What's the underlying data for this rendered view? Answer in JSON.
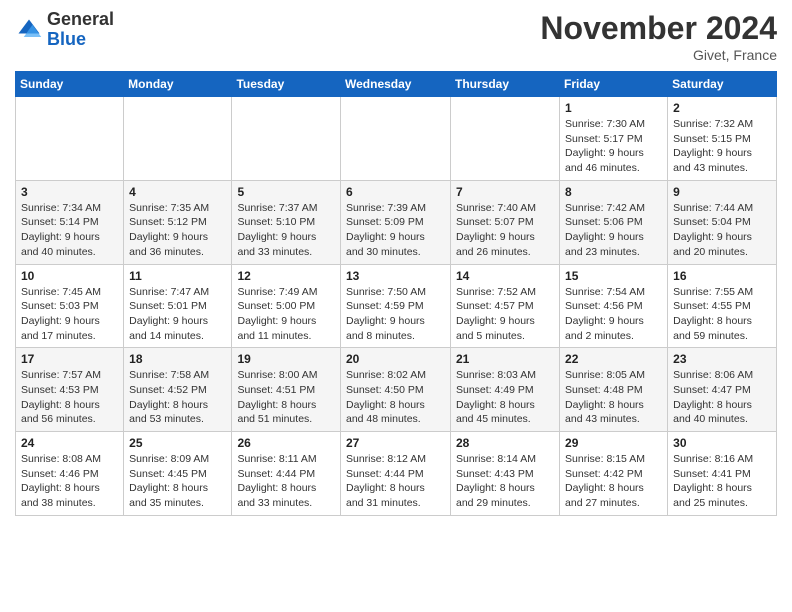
{
  "logo": {
    "line1": "General",
    "line2": "Blue"
  },
  "title": "November 2024",
  "location": "Givet, France",
  "days_of_week": [
    "Sunday",
    "Monday",
    "Tuesday",
    "Wednesday",
    "Thursday",
    "Friday",
    "Saturday"
  ],
  "weeks": [
    [
      null,
      null,
      null,
      null,
      null,
      {
        "day": "1",
        "sunrise": "7:30 AM",
        "sunset": "5:17 PM",
        "daylight": "9 hours and 46 minutes."
      },
      {
        "day": "2",
        "sunrise": "7:32 AM",
        "sunset": "5:15 PM",
        "daylight": "9 hours and 43 minutes."
      }
    ],
    [
      {
        "day": "3",
        "sunrise": "7:34 AM",
        "sunset": "5:14 PM",
        "daylight": "9 hours and 40 minutes."
      },
      {
        "day": "4",
        "sunrise": "7:35 AM",
        "sunset": "5:12 PM",
        "daylight": "9 hours and 36 minutes."
      },
      {
        "day": "5",
        "sunrise": "7:37 AM",
        "sunset": "5:10 PM",
        "daylight": "9 hours and 33 minutes."
      },
      {
        "day": "6",
        "sunrise": "7:39 AM",
        "sunset": "5:09 PM",
        "daylight": "9 hours and 30 minutes."
      },
      {
        "day": "7",
        "sunrise": "7:40 AM",
        "sunset": "5:07 PM",
        "daylight": "9 hours and 26 minutes."
      },
      {
        "day": "8",
        "sunrise": "7:42 AM",
        "sunset": "5:06 PM",
        "daylight": "9 hours and 23 minutes."
      },
      {
        "day": "9",
        "sunrise": "7:44 AM",
        "sunset": "5:04 PM",
        "daylight": "9 hours and 20 minutes."
      }
    ],
    [
      {
        "day": "10",
        "sunrise": "7:45 AM",
        "sunset": "5:03 PM",
        "daylight": "9 hours and 17 minutes."
      },
      {
        "day": "11",
        "sunrise": "7:47 AM",
        "sunset": "5:01 PM",
        "daylight": "9 hours and 14 minutes."
      },
      {
        "day": "12",
        "sunrise": "7:49 AM",
        "sunset": "5:00 PM",
        "daylight": "9 hours and 11 minutes."
      },
      {
        "day": "13",
        "sunrise": "7:50 AM",
        "sunset": "4:59 PM",
        "daylight": "9 hours and 8 minutes."
      },
      {
        "day": "14",
        "sunrise": "7:52 AM",
        "sunset": "4:57 PM",
        "daylight": "9 hours and 5 minutes."
      },
      {
        "day": "15",
        "sunrise": "7:54 AM",
        "sunset": "4:56 PM",
        "daylight": "9 hours and 2 minutes."
      },
      {
        "day": "16",
        "sunrise": "7:55 AM",
        "sunset": "4:55 PM",
        "daylight": "8 hours and 59 minutes."
      }
    ],
    [
      {
        "day": "17",
        "sunrise": "7:57 AM",
        "sunset": "4:53 PM",
        "daylight": "8 hours and 56 minutes."
      },
      {
        "day": "18",
        "sunrise": "7:58 AM",
        "sunset": "4:52 PM",
        "daylight": "8 hours and 53 minutes."
      },
      {
        "day": "19",
        "sunrise": "8:00 AM",
        "sunset": "4:51 PM",
        "daylight": "8 hours and 51 minutes."
      },
      {
        "day": "20",
        "sunrise": "8:02 AM",
        "sunset": "4:50 PM",
        "daylight": "8 hours and 48 minutes."
      },
      {
        "day": "21",
        "sunrise": "8:03 AM",
        "sunset": "4:49 PM",
        "daylight": "8 hours and 45 minutes."
      },
      {
        "day": "22",
        "sunrise": "8:05 AM",
        "sunset": "4:48 PM",
        "daylight": "8 hours and 43 minutes."
      },
      {
        "day": "23",
        "sunrise": "8:06 AM",
        "sunset": "4:47 PM",
        "daylight": "8 hours and 40 minutes."
      }
    ],
    [
      {
        "day": "24",
        "sunrise": "8:08 AM",
        "sunset": "4:46 PM",
        "daylight": "8 hours and 38 minutes."
      },
      {
        "day": "25",
        "sunrise": "8:09 AM",
        "sunset": "4:45 PM",
        "daylight": "8 hours and 35 minutes."
      },
      {
        "day": "26",
        "sunrise": "8:11 AM",
        "sunset": "4:44 PM",
        "daylight": "8 hours and 33 minutes."
      },
      {
        "day": "27",
        "sunrise": "8:12 AM",
        "sunset": "4:44 PM",
        "daylight": "8 hours and 31 minutes."
      },
      {
        "day": "28",
        "sunrise": "8:14 AM",
        "sunset": "4:43 PM",
        "daylight": "8 hours and 29 minutes."
      },
      {
        "day": "29",
        "sunrise": "8:15 AM",
        "sunset": "4:42 PM",
        "daylight": "8 hours and 27 minutes."
      },
      {
        "day": "30",
        "sunrise": "8:16 AM",
        "sunset": "4:41 PM",
        "daylight": "8 hours and 25 minutes."
      }
    ]
  ]
}
